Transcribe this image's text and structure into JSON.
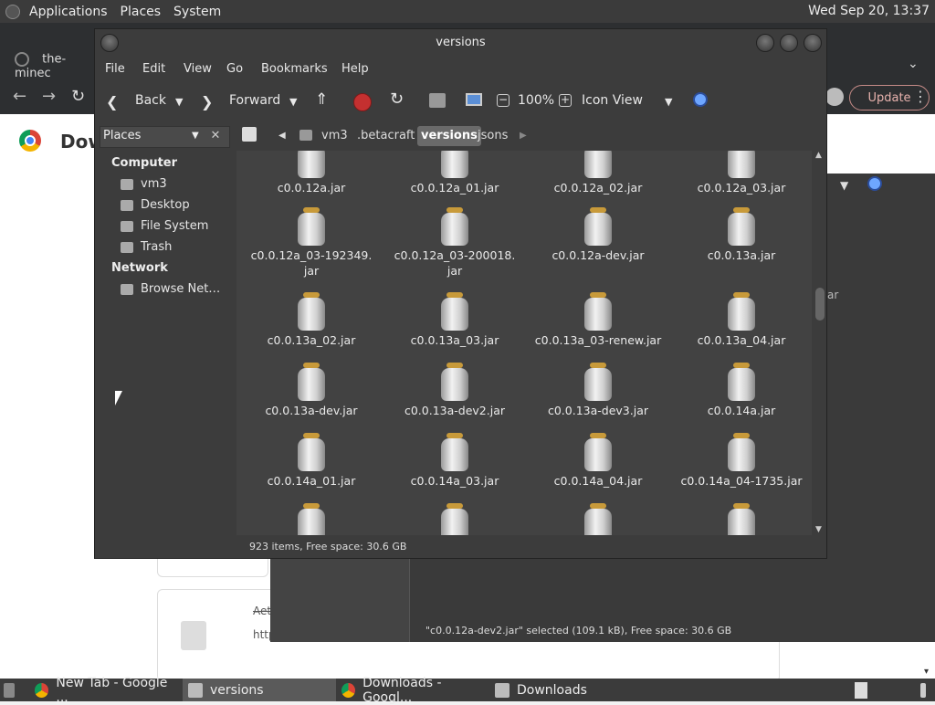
{
  "top_panel": {
    "menus": [
      "Applications",
      "Places",
      "System"
    ],
    "clock": "Wed Sep 20, 13:37"
  },
  "chrome": {
    "tab_title": "the-minec",
    "page_heading": "Dow",
    "update_label": "Update",
    "card_text_1": "Aet",
    "card_text_2": "http",
    "partial_text": "ar"
  },
  "bg_window": {
    "status": "\"c0.0.12a-dev2.jar\" selected (109.1 kB), Free space: 30.6 GB"
  },
  "window": {
    "title": "versions",
    "menus": [
      "File",
      "Edit",
      "View",
      "Go",
      "Bookmarks",
      "Help"
    ],
    "toolbar": {
      "back": "Back",
      "forward": "Forward",
      "zoom": "100%",
      "view_mode": "Icon View"
    },
    "sidebar_select": "Places",
    "sidebar": {
      "computer_header": "Computer",
      "computer_items": [
        "vm3",
        "Desktop",
        "File System",
        "Trash"
      ],
      "network_header": "Network",
      "network_items": [
        "Browse Net…"
      ]
    },
    "breadcrumbs": [
      "vm3",
      ".betacraft",
      "versions",
      "jsons"
    ],
    "files": [
      "c0.0.12a.jar",
      "c0.0.12a_01.jar",
      "c0.0.12a_02.jar",
      "c0.0.12a_03.jar",
      "c0.0.12a_03-192349.\njar",
      "c0.0.12a_03-200018.\njar",
      "c0.0.12a-dev.jar",
      "c0.0.13a.jar",
      "c0.0.13a_02.jar",
      "c0.0.13a_03.jar",
      "c0.0.13a_03-renew.jar",
      "c0.0.13a_04.jar",
      "c0.0.13a-dev.jar",
      "c0.0.13a-dev2.jar",
      "c0.0.13a-dev3.jar",
      "c0.0.14a.jar",
      "c0.0.14a_01.jar",
      "c0.0.14a_03.jar",
      "c0.0.14a_04.jar",
      "c0.0.14a_04-1735.jar",
      "",
      "",
      "",
      ""
    ],
    "status": "923 items, Free space: 30.6 GB"
  },
  "taskbar": {
    "tasks": [
      "New Tab - Google ...",
      "versions",
      "Downloads - Googl...",
      "Downloads"
    ]
  },
  "colors": {
    "panel": "#3b3b3b",
    "window_bg": "#3c3c3c",
    "content_bg": "#424242",
    "jar_lid": "#c89a3a"
  }
}
